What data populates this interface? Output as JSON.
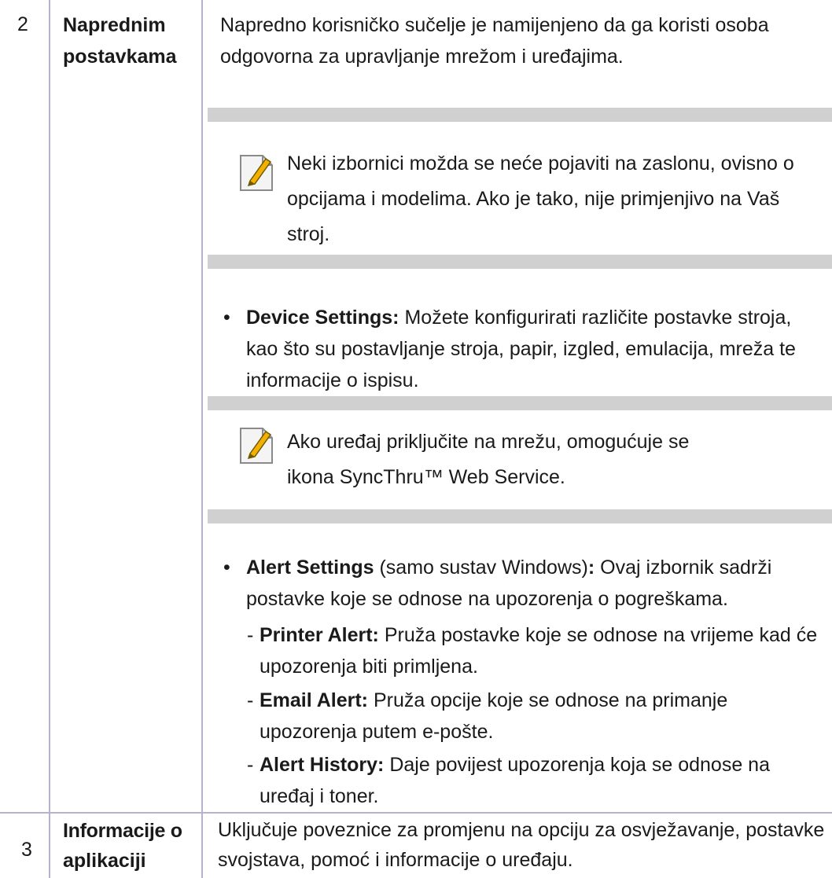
{
  "rows": [
    {
      "number": "2",
      "heading_lines": [
        "Naprednim",
        "postavkama"
      ],
      "intro": "Napredno korisničko sučelje je namijenjeno da ga koristi osoba odgovorna za upravljanje mrežom i uređajima.",
      "note1": "Neki izbornici možda se neće pojaviti na zaslonu, ovisno o opcijama i modelima. Ako je tako, nije primjenjivo na Vaš stroj.",
      "bullet1": {
        "label": "Device Settings:",
        "text": "Možete konfigurirati različite postavke stroja, kao što su postavljanje stroja, papir, izgled, emulacija, mreža te informacije o ispisu."
      },
      "note2": "Ako uređaj priključite na mrežu, omogućuje se ikona SyncThru™ Web Service.",
      "bullet2": {
        "label": "Alert Settings",
        "qualifier": "(samo sustav Windows)",
        "colon": ":",
        "text": "Ovaj izbornik sadrži postavke koje se odnose na upozorenja o pogreškama.",
        "subitems": [
          {
            "label": "Printer Alert:",
            "text": "Pruža postavke koje se odnose na vrijeme kad će upozorenja biti primljena."
          },
          {
            "label": "Email Alert:",
            "text": "Pruža opcije koje se odnose na primanje upozorenja putem e-pošte."
          },
          {
            "label": "Alert History:",
            "text": "Daje povijest upozorenja koja se odnose na uređaj i toner."
          }
        ]
      }
    },
    {
      "number": "3",
      "heading_lines": [
        "Informacije o",
        "aplikaciji"
      ],
      "text": "Uključuje poveznice za promjenu na opciju za osvježavanje, postavke svojstava, pomoć i informacije o uređaju."
    }
  ],
  "colors": {
    "rule": "#b7b3cc",
    "note_band": "#d0d0d0",
    "note_icon_accent": "#f3b000"
  },
  "icons": {
    "note": "pencil-note-icon"
  }
}
